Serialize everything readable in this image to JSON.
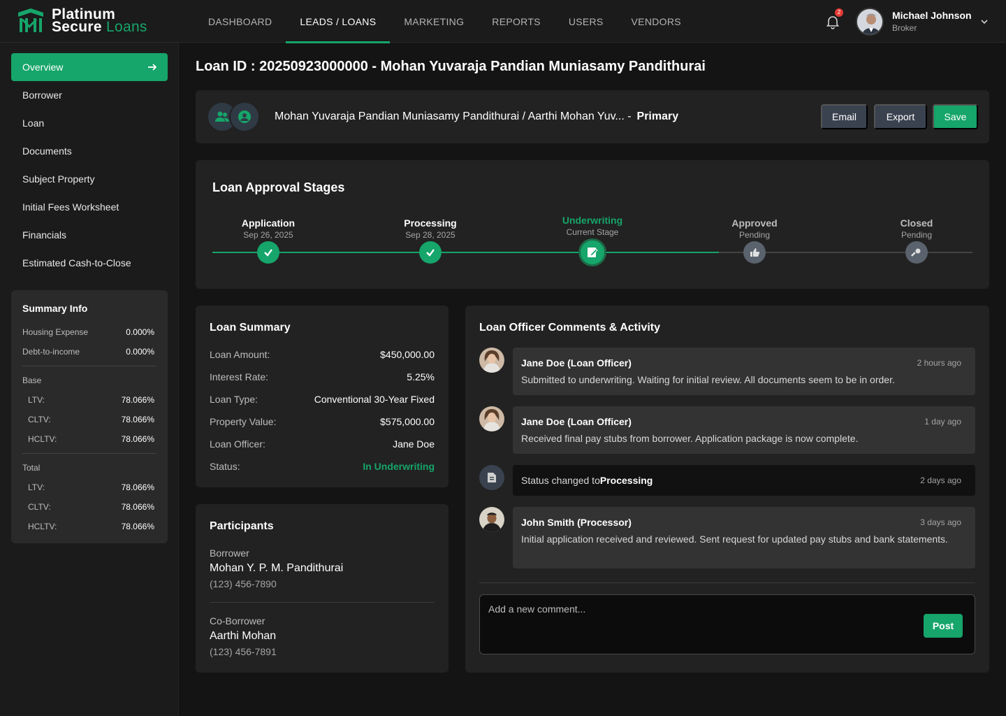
{
  "app": {
    "logo_line1": "Platinum",
    "logo_line2": "Secure",
    "logo_line2_accent": "Loans"
  },
  "nav": {
    "items": [
      {
        "label": "DASHBOARD"
      },
      {
        "label": "LEADS / LOANS"
      },
      {
        "label": "MARKETING"
      },
      {
        "label": "REPORTS"
      },
      {
        "label": "USERS"
      },
      {
        "label": "VENDORS"
      }
    ],
    "active": "LEADS / LOANS"
  },
  "notifications": {
    "count": "2",
    "icon": "bell-icon"
  },
  "user": {
    "name": "Michael Johnson",
    "role": "Broker"
  },
  "sidebar": {
    "items": [
      {
        "label": "Overview"
      },
      {
        "label": "Borrower"
      },
      {
        "label": "Loan"
      },
      {
        "label": "Documents"
      },
      {
        "label": "Subject Property"
      },
      {
        "label": "Initial Fees Worksheet"
      },
      {
        "label": "Financials"
      },
      {
        "label": "Estimated Cash-to-Close"
      }
    ],
    "active": "Overview"
  },
  "summary_info": {
    "title": "Summary Info",
    "housing_expense": {
      "label": "Housing Expense",
      "value": "0.000%"
    },
    "dti": {
      "label": "Debt-to-income",
      "value": "0.000%"
    },
    "base": {
      "label": "Base",
      "ltv": {
        "label": "LTV:",
        "value": "78.066%"
      },
      "cltv": {
        "label": "CLTV:",
        "value": "78.066%"
      },
      "hcltv": {
        "label": "HCLTV:",
        "value": "78.066%"
      }
    },
    "total": {
      "label": "Total",
      "ltv": {
        "label": "LTV:",
        "value": "78.066%"
      },
      "cltv": {
        "label": "CLTV:",
        "value": "78.066%"
      },
      "hcltv": {
        "label": "HCLTV:",
        "value": "78.066%"
      }
    }
  },
  "page": {
    "title": "Loan ID : 20250923000000 - Mohan Yuvaraja Pandian Muniasamy Pandithurai"
  },
  "borrower_bar": {
    "names": "Mohan Yuvaraja Pandian Muniasamy Pandithurai / Aarthi Mohan Yuv... -",
    "primary": "Primary",
    "email_label": "Email",
    "export_label": "Export",
    "save_label": "Save"
  },
  "stages": {
    "title": "Loan Approval Stages",
    "items": [
      {
        "name": "Application",
        "sub": "Sep 26, 2025",
        "state": "done"
      },
      {
        "name": "Processing",
        "sub": "Sep 28, 2025",
        "state": "done"
      },
      {
        "name": "Underwriting",
        "sub": "Current Stage",
        "state": "current"
      },
      {
        "name": "Approved",
        "sub": "Pending",
        "state": "pending"
      },
      {
        "name": "Closed",
        "sub": "Pending",
        "state": "pending"
      }
    ]
  },
  "loan_summary": {
    "title": "Loan Summary",
    "rows": [
      {
        "label": "Loan Amount:",
        "value": "$450,000.00"
      },
      {
        "label": "Interest Rate:",
        "value": "5.25%"
      },
      {
        "label": "Loan Type:",
        "value": "Conventional 30-Year Fixed"
      },
      {
        "label": "Property Value:",
        "value": "$575,000.00"
      },
      {
        "label": "Loan Officer:",
        "value": "Jane Doe"
      },
      {
        "label": "Status:",
        "value": "In Underwriting"
      }
    ]
  },
  "participants": {
    "title": "Participants",
    "borrower": {
      "role": "Borrower",
      "name": "Mohan Y. P. M. Pandithurai",
      "phone": "(123) 456-7890"
    },
    "co_borrower": {
      "role": "Co-Borrower",
      "name": "Aarthi Mohan",
      "phone": "(123) 456-7891"
    }
  },
  "activity": {
    "title": "Loan Officer Comments & Activity",
    "items": [
      {
        "author": "Jane Doe (Loan Officer)",
        "time": "2 hours ago",
        "text": "Submitted to underwriting. Waiting for initial review. All documents seem to be in order."
      },
      {
        "author": "Jane Doe (Loan Officer)",
        "time": "1 day ago",
        "text": "Received final pay stubs from borrower. Application package is now complete."
      },
      {
        "text_prefix": "Status changed to",
        "text_bold": "Processing",
        "time": "2 days ago"
      },
      {
        "author": "John Smith (Processor)",
        "time": "3 days ago",
        "text": "Initial application received and reviewed. Sent request for updated pay stubs and bank statements."
      }
    ],
    "comment_placeholder": "Add a new comment...",
    "post_label": "Post"
  },
  "colors": {
    "accent": "#16a56a",
    "background": "#141414",
    "card": "#222222",
    "button_gray": "#3a4250"
  }
}
